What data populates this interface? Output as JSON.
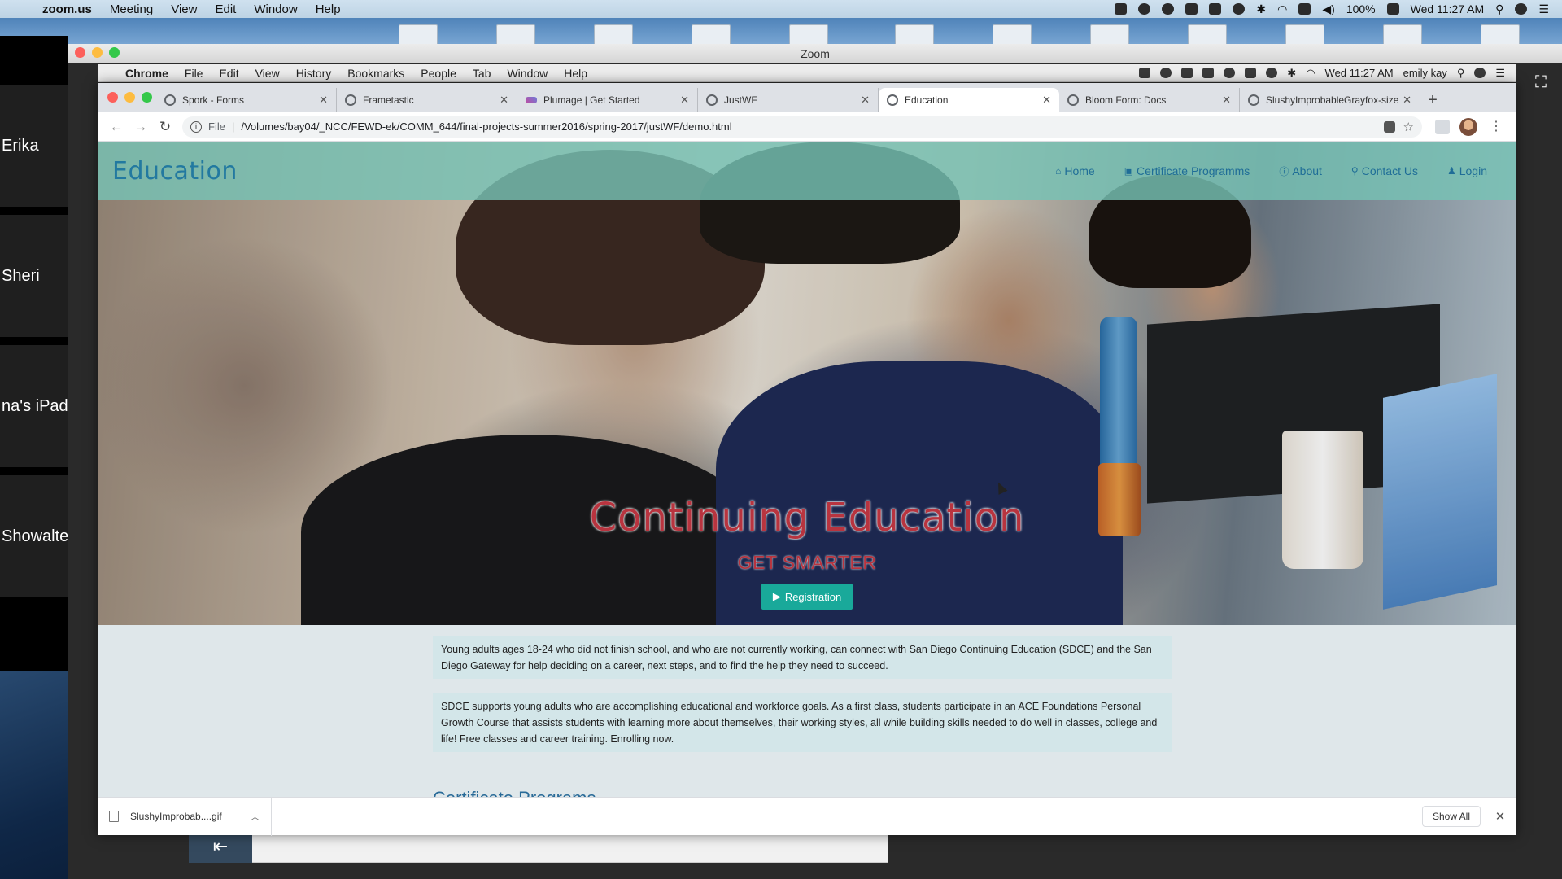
{
  "menubar": {
    "app": "zoom.us",
    "items": [
      "Meeting",
      "View",
      "Edit",
      "Window",
      "Help"
    ],
    "battery": "100%",
    "clock": "Wed 11:27 AM"
  },
  "zoom": {
    "title": "Zoom",
    "participants": [
      "Erika",
      "Sheri",
      "na's iPad",
      "Showalte"
    ],
    "back_label": "⇤"
  },
  "inner_menubar": {
    "app": "Chrome",
    "items": [
      "File",
      "Edit",
      "View",
      "History",
      "Bookmarks",
      "People",
      "Tab",
      "Window",
      "Help"
    ],
    "clock": "Wed 11:27 AM",
    "user": "emily kay"
  },
  "tabs": [
    {
      "title": "Spork - Forms",
      "icon": "globe-icon"
    },
    {
      "title": "Frametastic",
      "icon": "globe-icon"
    },
    {
      "title": "Plumage | Get Started",
      "icon": "feather-icon"
    },
    {
      "title": "JustWF",
      "icon": "globe-icon"
    },
    {
      "title": "Education",
      "icon": "globe-icon",
      "active": true
    },
    {
      "title": "Bloom Form: Docs",
      "icon": "globe-icon"
    },
    {
      "title": "SlushyImprobableGrayfox-size",
      "icon": "globe-icon"
    }
  ],
  "address": {
    "protocol": "File",
    "url": "/Volumes/bay04/_NCC/FEWD-ek/COMM_644/final-projects-summer2016/spring-2017/justWF/demo.html"
  },
  "site": {
    "brand": "Education",
    "nav": [
      {
        "icon": "⌂",
        "label": "Home"
      },
      {
        "icon": "▣",
        "label": "Certificate Programms"
      },
      {
        "icon": "ⓘ",
        "label": "About"
      },
      {
        "icon": "⚲",
        "label": "Contact Us"
      },
      {
        "icon": "♟",
        "label": "Login"
      }
    ],
    "hero_title": "Continuing Education",
    "hero_subtitle": "GET SMARTER",
    "cta": "Registration",
    "paragraph1": "Young adults ages 18-24 who did not finish school, and who are not currently working, can connect with San Diego Continuing Education (SDCE) and the San Diego Gateway for help deciding on a career, next steps, and to find the help they need to succeed.",
    "paragraph2": "SDCE supports young adults who are accomplishing educational and workforce goals. As a first class, students participate in an ACE Foundations Personal Growth Course that assists students with learning more about themselves, their working styles, all while building skills needed to do well in classes, college and life! Free classes and career training. Enrolling now.",
    "partial_heading": "Certificate Programs"
  },
  "downloads": {
    "file": "SlushyImprobab....gif",
    "show_all": "Show All"
  },
  "colors": {
    "nav_bg": "#76c2b5",
    "brand": "#2279a0",
    "hero_text": "#b8343f",
    "cta": "#19a99a"
  }
}
